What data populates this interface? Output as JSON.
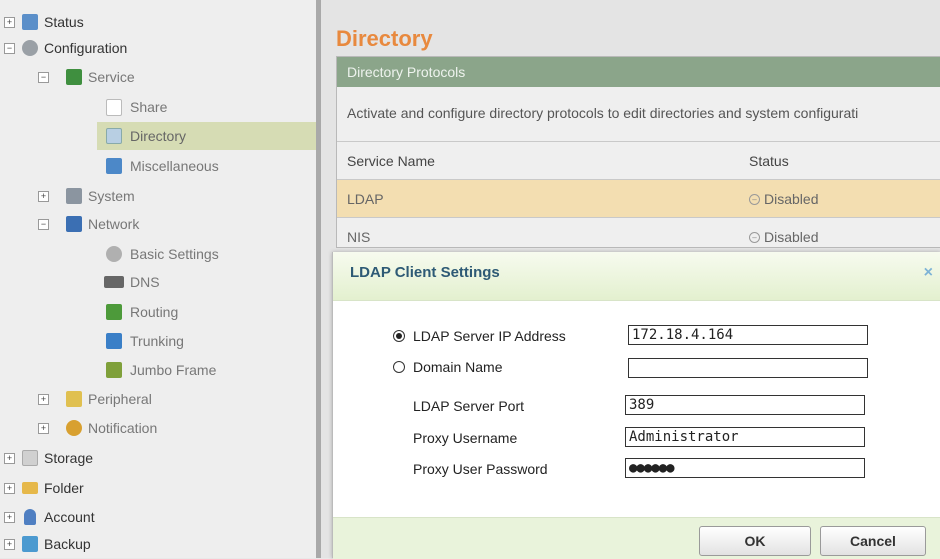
{
  "sidebar": {
    "items": [
      {
        "label": "Status",
        "expander": "+",
        "icon": "status-icon",
        "color": "#5b8fc9"
      },
      {
        "label": "Configuration",
        "expander": "−",
        "icon": "gear-icon",
        "color": "#9aa0a6"
      },
      {
        "label": "Service",
        "expander": "−",
        "icon": "service-icon",
        "color": "#3f8f3f"
      },
      {
        "label": "Share",
        "expander": "",
        "icon": "document-icon",
        "color": "#cfcfcf"
      },
      {
        "label": "Directory",
        "expander": "",
        "icon": "directory-icon",
        "color": "#7aa6cf"
      },
      {
        "label": "Miscellaneous",
        "expander": "",
        "icon": "window-icon",
        "color": "#4c88c8"
      },
      {
        "label": "System",
        "expander": "+",
        "icon": "system-icon",
        "color": "#8b95a0"
      },
      {
        "label": "Network",
        "expander": "−",
        "icon": "network-icon",
        "color": "#3b6fb3"
      },
      {
        "label": "Basic Settings",
        "expander": "",
        "icon": "settings-icon",
        "color": "#a3a3a3"
      },
      {
        "label": "DNS",
        "expander": "",
        "icon": "dns-icon",
        "color": "#666666"
      },
      {
        "label": "Routing",
        "expander": "",
        "icon": "routing-icon",
        "color": "#4d9a3a"
      },
      {
        "label": "Trunking",
        "expander": "",
        "icon": "trunking-icon",
        "color": "#3a7fc7"
      },
      {
        "label": "Jumbo Frame",
        "expander": "",
        "icon": "jumbo-frame-icon",
        "color": "#7fa03a"
      },
      {
        "label": "Peripheral",
        "expander": "+",
        "icon": "peripheral-icon",
        "color": "#e0c050"
      },
      {
        "label": "Notification",
        "expander": "+",
        "icon": "notification-icon",
        "color": "#d8a030"
      },
      {
        "label": "Storage",
        "expander": "+",
        "icon": "storage-icon",
        "color": "#c8c8c8"
      },
      {
        "label": "Folder",
        "expander": "+",
        "icon": "folder-icon",
        "color": "#e6b84a"
      },
      {
        "label": "Account",
        "expander": "+",
        "icon": "account-icon",
        "color": "#4f7fc2"
      },
      {
        "label": "Backup",
        "expander": "+",
        "icon": "backup-icon",
        "color": "#4c9ad0"
      }
    ]
  },
  "main": {
    "title": "Directory",
    "panel": {
      "header": "Directory Protocols",
      "description": "Activate and configure directory protocols to edit directories and system configurati",
      "columns": [
        "Service Name",
        "Status"
      ],
      "rows": [
        {
          "name": "LDAP",
          "status": "Disabled"
        },
        {
          "name": "NIS",
          "status": "Disabled"
        }
      ]
    }
  },
  "dialog": {
    "title": "LDAP Client Settings",
    "close": "×",
    "server_ip_label": "LDAP Server IP Address",
    "server_ip_value": "172.18.4.164",
    "domain_label": "Domain Name",
    "domain_value": "",
    "port_label": "LDAP Server Port",
    "port_value": "389",
    "proxy_user_label": "Proxy Username",
    "proxy_user_value": "Administrator",
    "proxy_pass_label": "Proxy User Password",
    "proxy_pass_value": "●●●●●●",
    "ok": "OK",
    "cancel": "Cancel"
  },
  "colors": {
    "accent": "#e8893e",
    "panel_header": "#8ba58a",
    "highlight_row": "#f3deb1",
    "dialog_title": "#2e5a75"
  }
}
